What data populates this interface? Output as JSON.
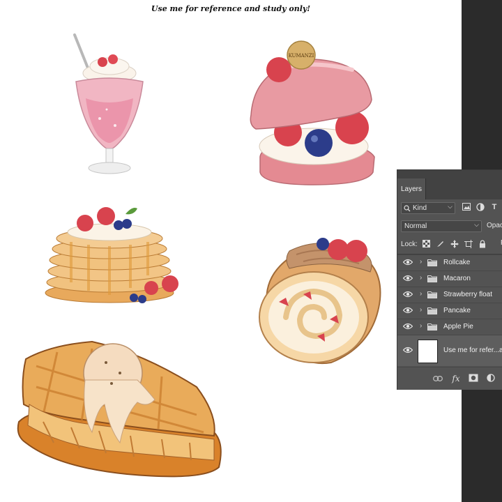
{
  "canvas": {
    "caption": "Use me for reference and study only!",
    "macaron_medallion_text": "KUMANZI"
  },
  "layers_panel": {
    "tab_label": "Layers",
    "filter_kind": "Kind",
    "blend_mode": "Normal",
    "opacity_label": "Opaci",
    "lock_label": "Lock:",
    "fill_label_fragment": "F",
    "layers": [
      {
        "name": "Rollcake",
        "type": "group",
        "visible": true
      },
      {
        "name": "Macaron",
        "type": "group",
        "visible": true
      },
      {
        "name": "Strawberry float",
        "type": "group",
        "visible": true
      },
      {
        "name": "Pancake",
        "type": "group",
        "visible": true
      },
      {
        "name": "Apple Pie",
        "type": "group",
        "visible": true
      },
      {
        "name": "Use me for refer...an",
        "type": "layer",
        "visible": true
      }
    ],
    "bottom_icons": [
      "link-icon",
      "fx-icon",
      "mask-icon",
      "adjustment-icon"
    ],
    "fx_label": "fx"
  },
  "colors": {
    "panel_bg": "#535353",
    "panel_header": "#424242",
    "workspace": "#2b2b2b"
  }
}
